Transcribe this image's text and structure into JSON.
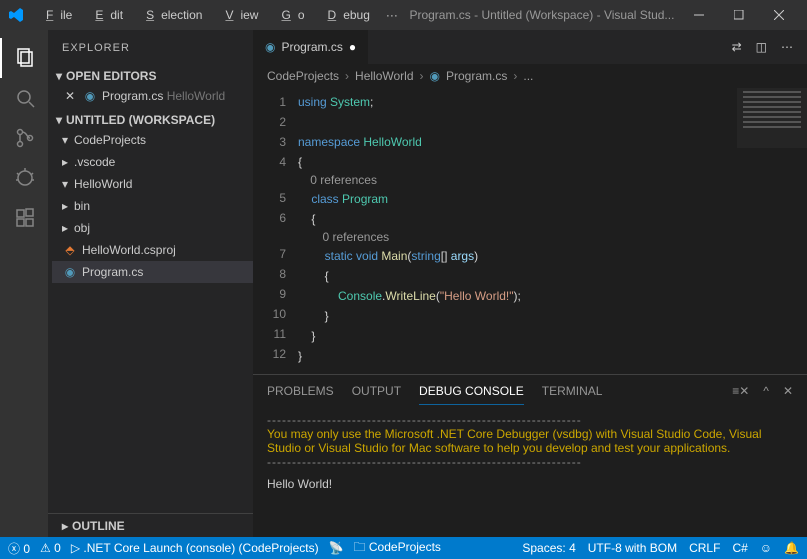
{
  "titlebar": {
    "menus": [
      "File",
      "Edit",
      "Selection",
      "View",
      "Go",
      "Debug",
      "···"
    ],
    "title": "Program.cs - Untitled (Workspace) - Visual Stud..."
  },
  "sidebar": {
    "header": "EXPLORER",
    "sections": {
      "openEditors": "OPEN EDITORS",
      "openEditorItem": "Program.cs",
      "openEditorHint": "HelloWorld",
      "workspace": "UNTITLED (WORKSPACE)",
      "outline": "OUTLINE"
    },
    "tree": {
      "root": "CodeProjects",
      "vscode": ".vscode",
      "hello": "HelloWorld",
      "bin": "bin",
      "obj": "obj",
      "csproj": "HelloWorld.csproj",
      "program": "Program.cs"
    }
  },
  "tabs": {
    "active": "Program.cs"
  },
  "breadcrumb": [
    "CodeProjects",
    "HelloWorld",
    "Program.cs",
    "..."
  ],
  "code": {
    "lineNumbers": [
      "1",
      "2",
      "3",
      "4",
      "",
      "5",
      "6",
      "",
      "7",
      "8",
      "9",
      "10",
      "11",
      "12"
    ],
    "codelens": "0 references"
  },
  "panel": {
    "tabs": [
      "PROBLEMS",
      "OUTPUT",
      "DEBUG CONSOLE",
      "TERMINAL"
    ],
    "active": 2,
    "dash": "---------------------------------------------------------------",
    "warn": "You may only use the Microsoft .NET Core Debugger (vsdbg) with Visual Studio Code, Visual Studio or Visual Studio for Mac software to help you develop and test your applications.",
    "output": "Hello World!"
  },
  "status": {
    "errors": "0",
    "warnings": "0",
    "launch": ".NET Core Launch (console) (CodeProjects)",
    "folder": "CodeProjects",
    "spaces": "Spaces: 4",
    "encoding": "UTF-8 with BOM",
    "eol": "CRLF",
    "lang": "C#"
  }
}
